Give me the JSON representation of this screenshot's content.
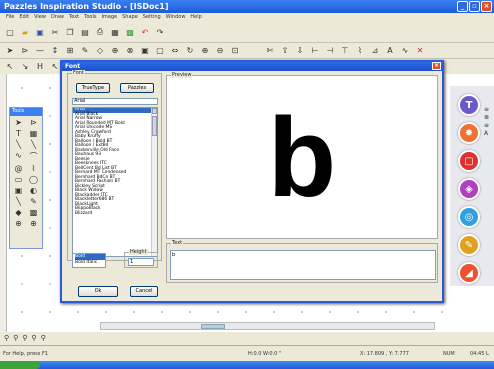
{
  "app": {
    "title": "Pazzles Inspiration Studio - [ISDoc1]",
    "menu": [
      "File",
      "Edit",
      "View",
      "Draw",
      "Text",
      "Tools",
      "Image",
      "Shape",
      "Setting",
      "Window",
      "Help"
    ]
  },
  "dialog": {
    "title": "Font",
    "font_group_label": "Font",
    "truetype_button": "TrueType",
    "pazzles_button": "Pazzles",
    "font_input_value": "Arial",
    "font_list": [
      "Arial",
      "Arial Black",
      "Arial Narrow",
      "Arial Rounded MT Bold",
      "Arial Unicode MS",
      "Ashley Crawford",
      "Baby Kruffy",
      "Balloon / Bold BT",
      "Balloon / ExtBd",
      "Baskerville Old Face",
      "Bauhaus 93",
      "Beesie",
      "Beesknees ITC",
      "BellCent Bd List BT",
      "Bernard MT Condensed",
      "Bernhard BdCn BT",
      "Bernhard Fashion BT",
      "Bickley Script",
      "Black Widow",
      "Blackadder ITC",
      "Blackletter686 BT",
      "BlackLight",
      "BlippoBlack",
      "Blizzard"
    ],
    "selected_font_index": 0,
    "style_options": [
      "Bold",
      "Bold Italic"
    ],
    "selected_style_index": 0,
    "height_label": "Height",
    "height_value": "1",
    "ok_button": "Ok",
    "cancel_button": "Cancel",
    "preview_label": "Preview",
    "preview_text": "b",
    "text_label": "Text",
    "text_value": "b"
  },
  "status": {
    "help": "For Help, press F1",
    "size": "H:0.0  W:0.0 \"",
    "coords": "X: 17.809 , Y: 7.777",
    "mode": "NUM",
    "time": "04:45 L"
  },
  "right_panel": [
    {
      "letter": "T",
      "color": "#6a5ac8"
    },
    {
      "letter": "",
      "color": "#f07030"
    },
    {
      "letter": "",
      "color": "#e03030"
    },
    {
      "letter": "",
      "color": "#b040c0"
    },
    {
      "letter": "",
      "color": "#30a0e0"
    },
    {
      "letter": "",
      "color": "#e0a020"
    },
    {
      "letter": "",
      "color": "#f05030"
    }
  ]
}
